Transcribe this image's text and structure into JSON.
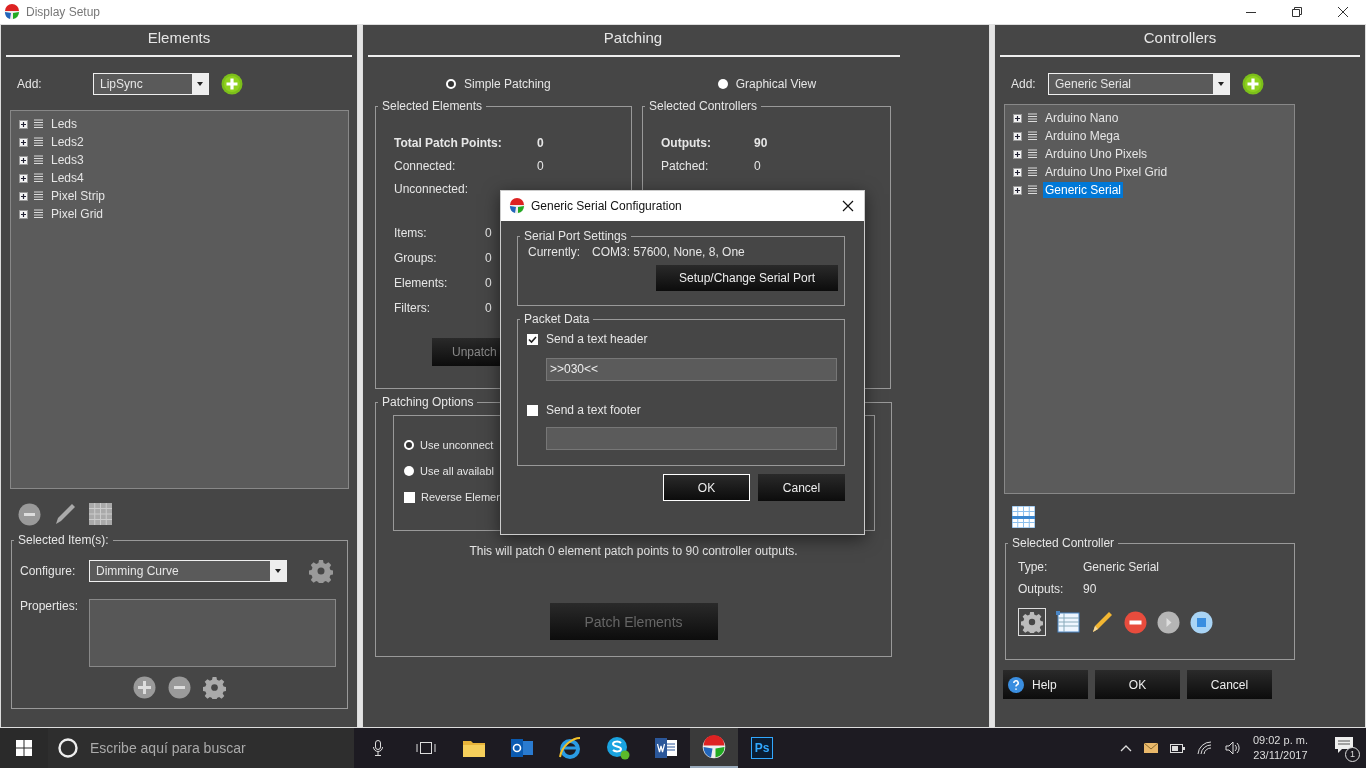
{
  "window": {
    "title": "Display Setup"
  },
  "elements_panel": {
    "heading": "Elements",
    "add_label": "Add:",
    "add_select": "LipSync",
    "tree": [
      {
        "label": "Leds",
        "selected": false
      },
      {
        "label": "Leds2",
        "selected": false
      },
      {
        "label": "Leds3",
        "selected": false
      },
      {
        "label": "Leds4",
        "selected": false
      },
      {
        "label": "Pixel Strip",
        "selected": false
      },
      {
        "label": "Pixel Grid",
        "selected": false
      }
    ],
    "selected_items": {
      "legend": "Selected Item(s):",
      "configure_label": "Configure:",
      "configure_select": "Dimming Curve",
      "properties_label": "Properties:"
    }
  },
  "patching_panel": {
    "heading": "Patching",
    "modes": [
      {
        "label": "Simple Patching",
        "selected": true
      },
      {
        "label": "Graphical View",
        "selected": false
      }
    ],
    "selected_elements": {
      "legend": "Selected Elements",
      "total": {
        "label": "Total Patch Points:",
        "value": "0"
      },
      "rows": [
        {
          "label": "Connected:",
          "value": "0"
        },
        {
          "label": "Unconnected:"
        }
      ],
      "counts": [
        {
          "label": "Items:",
          "value": "0"
        },
        {
          "label": "Groups:",
          "value": "0"
        },
        {
          "label": "Elements:",
          "value": "0"
        },
        {
          "label": "Filters:",
          "value": "0"
        }
      ],
      "button": "Unpatch"
    },
    "selected_controllers": {
      "legend": "Selected Controllers",
      "total": {
        "label": "Outputs:",
        "value": "90"
      },
      "rows": [
        {
          "label": "Patched:",
          "value": "0"
        }
      ]
    },
    "patching_options": {
      "legend": "Patching Options",
      "options": [
        {
          "kind": "radio",
          "label": "Use unconnect",
          "selected": true
        },
        {
          "kind": "radio",
          "label": "Use all availabl",
          "selected": false
        },
        {
          "kind": "checkbox",
          "label": "Reverse Elemen",
          "checked": false
        }
      ]
    },
    "summary": "This will patch 0 element patch points to 90 controller outputs.",
    "patch_button": {
      "label": "Patch Elements",
      "disabled": true
    }
  },
  "controllers_panel": {
    "heading": "Controllers",
    "add_label": "Add:",
    "add_select": "Generic Serial",
    "tree": [
      {
        "label": "Arduino Nano",
        "selected": false
      },
      {
        "label": "Arduino Mega",
        "selected": false
      },
      {
        "label": "Arduino Uno Pixels",
        "selected": false
      },
      {
        "label": "Arduino Uno Pixel Grid",
        "selected": false
      },
      {
        "label": "Generic Serial",
        "selected": true
      }
    ],
    "selected_controller": {
      "legend": "Selected Controller",
      "rows": [
        {
          "label": "Type:",
          "value": "Generic Serial"
        },
        {
          "label": "Outputs:",
          "value": "90"
        }
      ]
    },
    "buttons": [
      {
        "kind": "help",
        "label": "Help"
      },
      {
        "kind": "plain",
        "label": "OK"
      },
      {
        "kind": "plain",
        "label": "Cancel"
      }
    ]
  },
  "dialog": {
    "title": "Generic Serial Configuration",
    "serial_port": {
      "legend": "Serial Port Settings",
      "current_label": "Currently:",
      "current_value": "COM3: 57600, None, 8, One",
      "button": "Setup/Change Serial Port"
    },
    "packet_data": {
      "legend": "Packet Data",
      "header": {
        "label": "Send a text header",
        "checked": true,
        "value": ">>030<<"
      },
      "footer": {
        "label": "Send a text footer",
        "checked": false
      }
    },
    "buttons": [
      {
        "label": "OK",
        "focused": true
      },
      {
        "label": "Cancel",
        "focused": false
      }
    ]
  },
  "taskbar": {
    "search_placeholder": "Escribe aquí para buscar",
    "ps_label": "Ps",
    "time": "09:02 p. m.",
    "date": "23/11/2017",
    "notifications": "1"
  }
}
